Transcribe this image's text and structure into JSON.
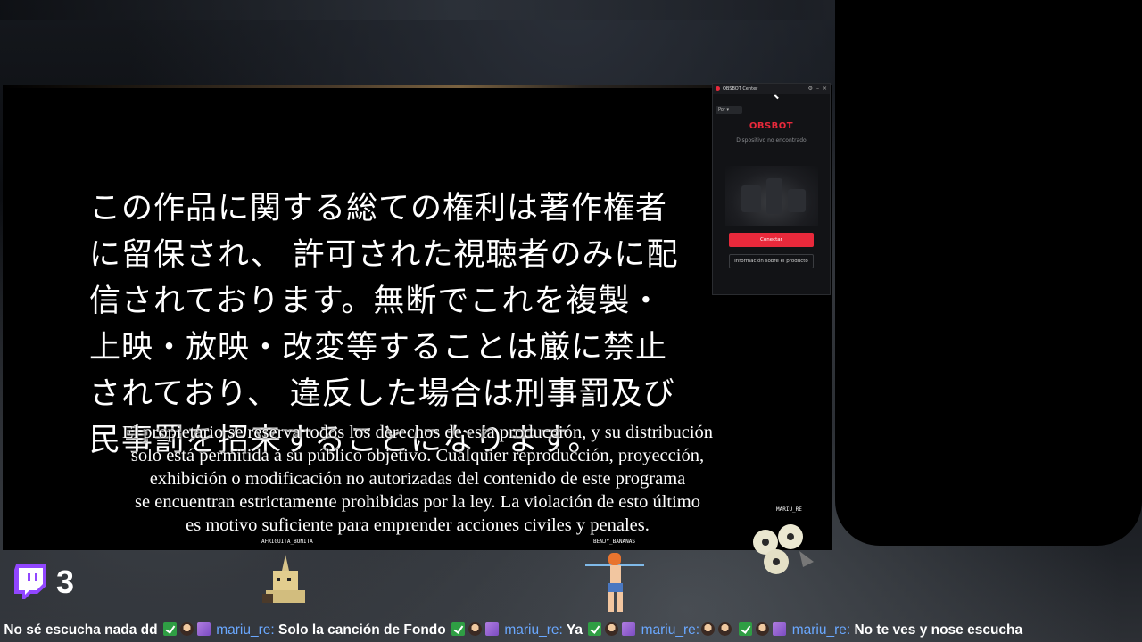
{
  "video": {
    "japanese_lines": [
      "この作品に関する総ての権利は著作権者",
      "に留保され、 許可された視聴者のみに配",
      "信されております。無断でこれを複製・",
      "上映・放映・改変等することは厳に禁止",
      "されており、 違反した場合は刑事罰及び",
      "民事罰を招来することになります。"
    ],
    "spanish_lines": [
      "El propietario se reserva todos los derechos de esta producción, y su distribución",
      "solo está permitida a su público objetivo. Cualquier reproducción, proyección,",
      "exhibición o modificación no autorizadas del contenido de este programa",
      "se encuentran estrictamente prohibidas por la ley. La violación de esto último",
      "es motivo suficiente para emprender acciones civiles y penales."
    ]
  },
  "obsbot": {
    "window_title": "OBSBOT Center",
    "language": "Por",
    "logo": "OBSBOT",
    "status": "Dispositivo no encontrado",
    "connect_label": "Conectar",
    "info_label": "Información sobre el producto",
    "accent": "#e8293b"
  },
  "overlay": {
    "viewer_count": "3",
    "platform_icon": "twitch-icon",
    "chatters": [
      {
        "name": "AFRIGUITA_BONITA"
      },
      {
        "name": "BENJY_BANANAS"
      },
      {
        "name": "MARIU_RE"
      }
    ]
  },
  "ticker": {
    "messages": [
      {
        "user": "",
        "text": "No sé escucha nada dd"
      },
      {
        "user": "mariu_re:",
        "text": "Solo la canción de Fondo"
      },
      {
        "user": "mariu_re:",
        "text": "Ya"
      },
      {
        "user": "mariu_re:",
        "text": ""
      },
      {
        "user": "mariu_re:",
        "text": "No te ves y nose escucha"
      }
    ],
    "user_color": "#6aa8ff"
  }
}
